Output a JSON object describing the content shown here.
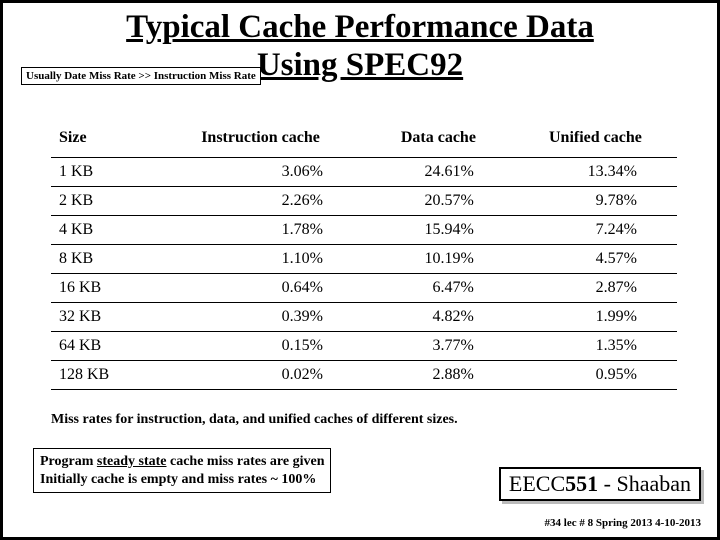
{
  "title_line1": "Typical Cache Performance Data",
  "title_line2": "Using SPEC92",
  "annotation": "Usually Date Miss Rate >> Instruction Miss Rate",
  "headers": {
    "c0": "Size",
    "c1": "Instruction cache",
    "c2": "Data cache",
    "c3": "Unified cache"
  },
  "chart_data": {
    "type": "table",
    "title": "Miss rates for instruction, data, and unified caches of different sizes.",
    "columns": [
      "Size",
      "Instruction cache",
      "Data cache",
      "Unified cache"
    ],
    "rows": [
      {
        "size": "1 KB",
        "instr": "3.06%",
        "data": "24.61%",
        "unified": "13.34%"
      },
      {
        "size": "2 KB",
        "instr": "2.26%",
        "data": "20.57%",
        "unified": "9.78%"
      },
      {
        "size": "4 KB",
        "instr": "1.78%",
        "data": "15.94%",
        "unified": "7.24%"
      },
      {
        "size": "8 KB",
        "instr": "1.10%",
        "data": "10.19%",
        "unified": "4.57%"
      },
      {
        "size": "16 KB",
        "instr": "0.64%",
        "data": "6.47%",
        "unified": "2.87%"
      },
      {
        "size": "32 KB",
        "instr": "0.39%",
        "data": "4.82%",
        "unified": "1.99%"
      },
      {
        "size": "64 KB",
        "instr": "0.15%",
        "data": "3.77%",
        "unified": "1.35%"
      },
      {
        "size": "128 KB",
        "instr": "0.02%",
        "data": "2.88%",
        "unified": "0.95%"
      }
    ]
  },
  "caption": "Miss rates for instruction, data, and unified caches of different sizes.",
  "footer_note_l1a": "Program ",
  "footer_note_l1b": "steady state",
  "footer_note_l1c": " cache miss rates are given",
  "footer_note_l2": "Initially cache is empty and miss rates ~ 100%",
  "course_a": "EECC",
  "course_b": "551",
  "course_c": " - Shaaban",
  "page_foot": "#34   lec # 8    Spring 2013  4-10-2013"
}
